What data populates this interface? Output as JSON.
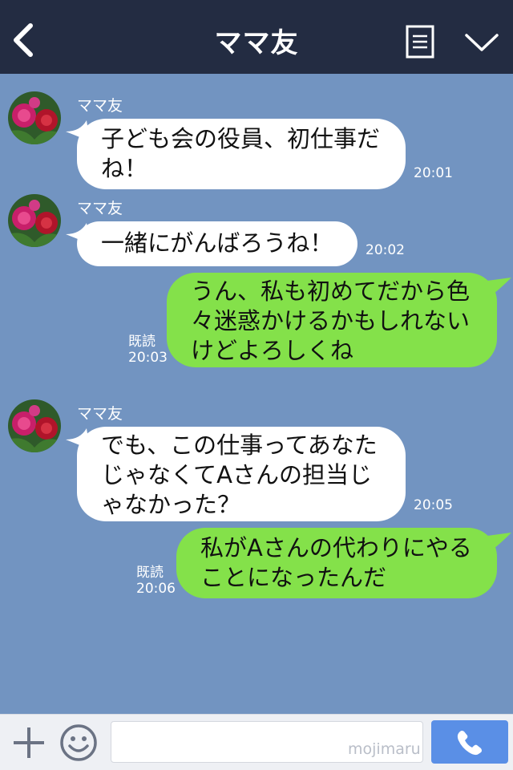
{
  "header": {
    "title": "ママ友",
    "back_icon": "chevron-left-icon",
    "menu_icon": "menu-list-icon",
    "collapse_icon": "chevron-down-icon"
  },
  "messages": [
    {
      "sender": "ママ友",
      "direction": "in",
      "line1": "子ども会の役員、初仕事だ",
      "line2": "ね！",
      "time": "20:01"
    },
    {
      "sender": "ママ友",
      "direction": "in",
      "line1": "一緒にがんばろうね！",
      "time": "20:02"
    },
    {
      "direction": "out",
      "line1": "うん、私も初めてだから色",
      "line2": "々迷惑かけるかもしれない",
      "line3": "けどよろしくね",
      "read": "既読",
      "time": "20:03"
    },
    {
      "sender": "ママ友",
      "direction": "in",
      "line1": "でも、この仕事ってあなた",
      "line2": "じゃなくてAさんの担当じ",
      "line3": "ゃなかった？",
      "time": "20:05"
    },
    {
      "direction": "out",
      "line1": "私がAさんの代わりにやる",
      "line2": "ことになったんだ",
      "read": "既読",
      "time": "20:06"
    }
  ],
  "bottom_bar": {
    "plus_icon": "plus-icon",
    "emoji_icon": "smiley-icon",
    "input_value": "",
    "watermark": "mojimaru",
    "call_icon": "phone-icon"
  },
  "colors": {
    "header_bg": "#232c42",
    "chat_bg": "#7294c1",
    "incoming_bubble": "#ffffff",
    "outgoing_bubble": "#84e14a",
    "call_button": "#5a8fe6"
  }
}
